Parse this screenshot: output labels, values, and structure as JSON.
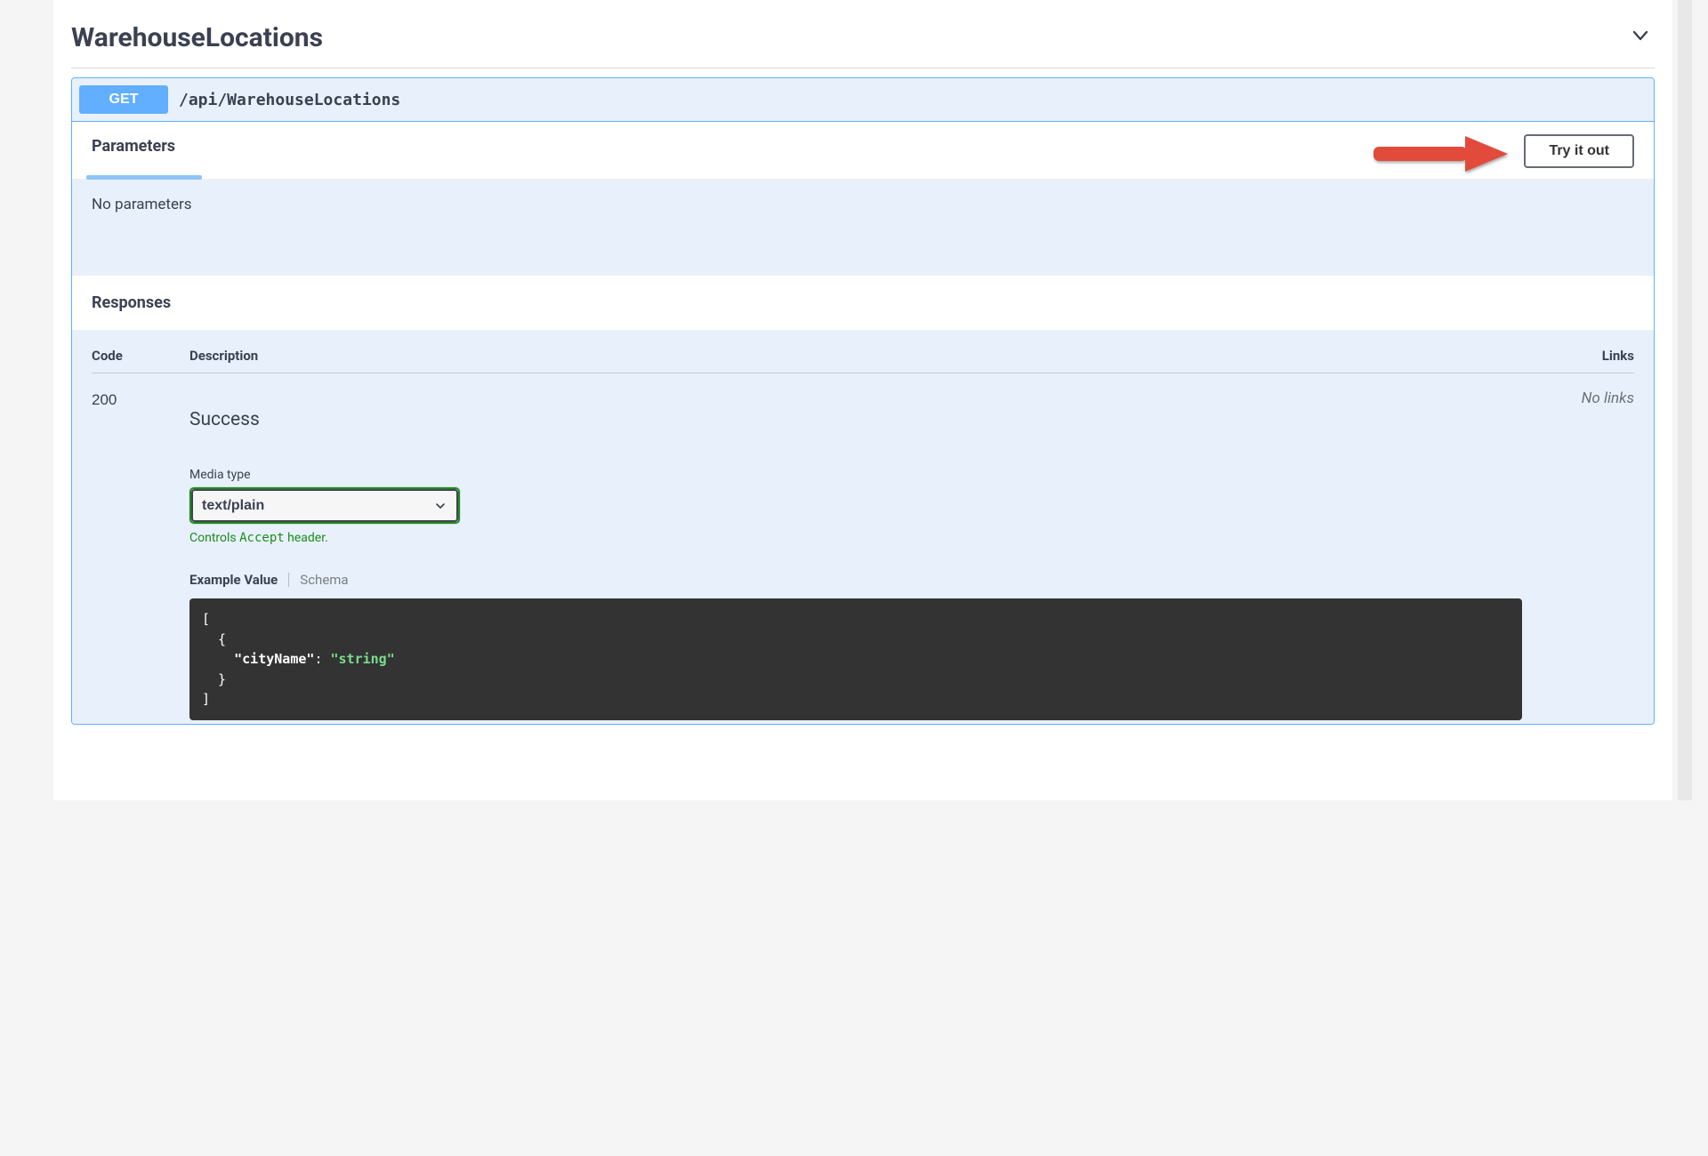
{
  "tag": {
    "name": "WarehouseLocations"
  },
  "operation": {
    "method": "GET",
    "path": "/api/WarehouseLocations"
  },
  "parameters": {
    "heading": "Parameters",
    "empty_text": "No parameters",
    "try_button": "Try it out"
  },
  "responses": {
    "heading": "Responses",
    "columns": {
      "code": "Code",
      "description": "Description",
      "links": "Links"
    },
    "rows": [
      {
        "code": "200",
        "description": "Success",
        "links_text": "No links",
        "media_type_label": "Media type",
        "media_type_value": "text/plain",
        "controls_prefix": "Controls ",
        "controls_header": "Accept",
        "controls_suffix": " header.",
        "tabs": {
          "example": "Example Value",
          "schema": "Schema"
        },
        "example": {
          "open_bracket": "[",
          "open_brace": "  {",
          "key": "\"cityName\"",
          "colon_space": ": ",
          "value": "\"string\"",
          "close_brace": "  }",
          "close_bracket": "]"
        }
      }
    ]
  }
}
